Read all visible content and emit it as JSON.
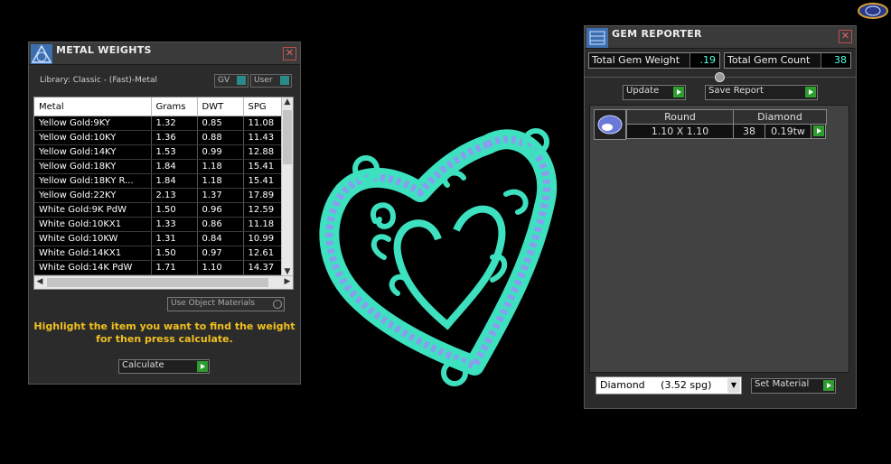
{
  "metal_weights": {
    "title": "METAL WEIGHTS",
    "library": "Library: Classic - (Fast)-Metal",
    "toggle_gv": "GV",
    "toggle_user": "User",
    "columns": [
      "Metal",
      "Grams",
      "DWT",
      "SPG"
    ],
    "rows": [
      [
        "Yellow Gold:9KY",
        "1.32",
        "0.85",
        "11.08"
      ],
      [
        "Yellow Gold:10KY",
        "1.36",
        "0.88",
        "11.43"
      ],
      [
        "Yellow Gold:14KY",
        "1.53",
        "0.99",
        "12.88"
      ],
      [
        "Yellow Gold:18KY",
        "1.84",
        "1.18",
        "15.41"
      ],
      [
        "Yellow Gold:18KY R...",
        "1.84",
        "1.18",
        "15.41"
      ],
      [
        "Yellow Gold:22KY",
        "2.13",
        "1.37",
        "17.89"
      ],
      [
        "White Gold:9K PdW",
        "1.50",
        "0.96",
        "12.59"
      ],
      [
        "White Gold:10KX1",
        "1.33",
        "0.86",
        "11.18"
      ],
      [
        "White Gold:10KW",
        "1.31",
        "0.84",
        "10.99"
      ],
      [
        "White Gold:14KX1",
        "1.50",
        "0.97",
        "12.61"
      ],
      [
        "White Gold:14K PdW",
        "1.71",
        "1.10",
        "14.37"
      ]
    ],
    "use_object_materials": "Use Object Materials",
    "hint": "Highlight the item you want to find the weight for then press calculate.",
    "calculate_label": "Calculate"
  },
  "gem_reporter": {
    "title": "GEM REPORTER",
    "total_gem_weight_label": "Total Gem Weight",
    "total_gem_weight_value": ".19",
    "total_gem_count_label": "Total Gem Count",
    "total_gem_count_value": "38",
    "update_label": "Update",
    "save_report_label": "Save Report",
    "gem": {
      "shape": "Round",
      "material": "Diamond",
      "size": "1.10 X 1.10",
      "count": "38",
      "weight": "0.19tw"
    },
    "material_select": "Diamond     (3.52 spg)",
    "set_material_label": "Set Material"
  },
  "colors": {
    "model": "#3de0bf",
    "gems": "#8a9ef0",
    "accent_green": "#2e9c2e",
    "hint_text": "#f0c020"
  }
}
